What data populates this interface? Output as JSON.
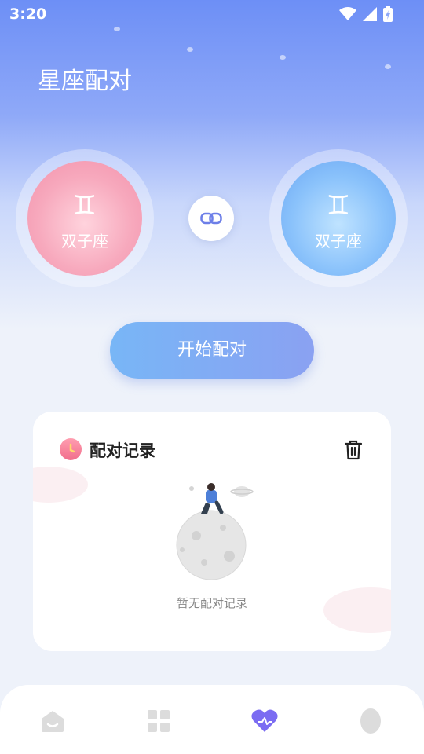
{
  "status": {
    "time": "3:20"
  },
  "header": {
    "title": "星座配对"
  },
  "pair": {
    "left": {
      "glyph": "♊",
      "name": "双子座"
    },
    "right": {
      "glyph": "♊",
      "name": "双子座"
    }
  },
  "actions": {
    "start_label": "开始配对"
  },
  "records": {
    "title": "配对记录",
    "empty_text": "暂无配对记录"
  },
  "tabbar": {
    "items": [
      "home-icon",
      "grid-icon",
      "heart-icon",
      "profile-icon"
    ],
    "active": "heart-icon"
  },
  "colors": {
    "accent": "#6d8ff6",
    "left_sign": "#f7a9bd",
    "right_sign": "#8ac2fb",
    "active_tab": "#7b6cf2"
  }
}
